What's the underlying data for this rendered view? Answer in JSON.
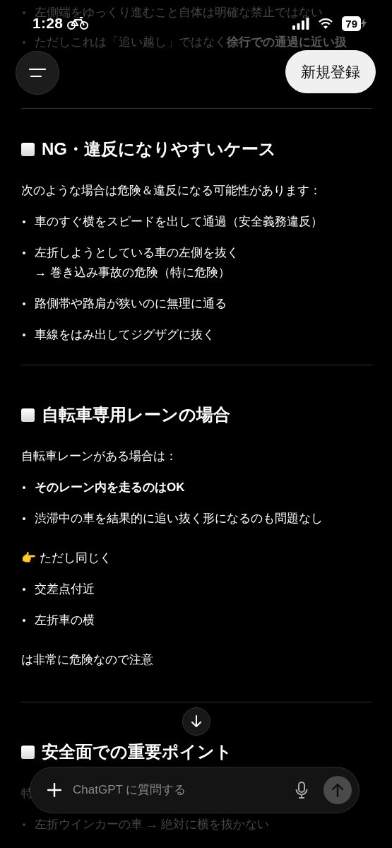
{
  "status_bar": {
    "time": "1:28",
    "battery": "79"
  },
  "top_bar": {
    "signup_button": "新規登録"
  },
  "content": [
    {
      "kind": "bullet",
      "text": "左側端をゆっくり進むこと自体は明確な禁止ではない",
      "faded": true,
      "bold": false
    },
    {
      "kind": "bullet",
      "text": "ただしこれは「追い越し」ではなく**徐行での通過に近い扱**",
      "faded": true,
      "bold": false
    },
    {
      "kind": "divider"
    },
    {
      "kind": "heading",
      "text": "NG・違反になりやすいケース",
      "faded": false
    },
    {
      "kind": "paragraph",
      "text": "次のような場合は危険＆違反になる可能性があります：",
      "faded": false
    },
    {
      "kind": "bullet",
      "text": "車のすぐ横をスピードを出して通過（安全義務違反）",
      "faded": false,
      "bold": false
    },
    {
      "kind": "bullet",
      "text": "左折しようとしている車の左側を抜く",
      "note": "→ 巻き込み事故の危険（特に危険）",
      "faded": false,
      "bold": false
    },
    {
      "kind": "bullet",
      "text": "路側帯や路肩が狭いのに無理に通る",
      "faded": false,
      "bold": false
    },
    {
      "kind": "bullet",
      "text": "車線をはみ出してジグザグに抜く",
      "faded": false,
      "bold": false
    },
    {
      "kind": "divider"
    },
    {
      "kind": "heading",
      "text": "自転車専用レーンの場合",
      "faded": false
    },
    {
      "kind": "paragraph",
      "text": "自転車レーンがある場合は：",
      "faded": false
    },
    {
      "kind": "bullet",
      "text": "そのレーン内を走るのはOK",
      "faded": false,
      "bold": true
    },
    {
      "kind": "bullet",
      "text": "渋滞中の車を結果的に追い抜く形になるのも問題なし",
      "faded": false,
      "bold": false
    },
    {
      "kind": "paragraph",
      "text": "👉 ただし同じく",
      "faded": false
    },
    {
      "kind": "bullet",
      "text": "交差点付近",
      "faded": false,
      "bold": false
    },
    {
      "kind": "bullet",
      "text": "左折車の横",
      "faded": false,
      "bold": false
    },
    {
      "kind": "paragraph",
      "text": "は非常に危険なので注意",
      "faded": false
    },
    {
      "kind": "divider"
    },
    {
      "kind": "heading",
      "text": "安全面での重要ポイント",
      "faded": false
    },
    {
      "kind": "paragraph",
      "text": "特",
      "faded": true
    },
    {
      "kind": "bullet",
      "text": "左折ウインカーの車 → 絶対に横を抜かない",
      "faded": true,
      "bold": false
    }
  ],
  "composer": {
    "placeholder": "ChatGPT に質問する"
  }
}
